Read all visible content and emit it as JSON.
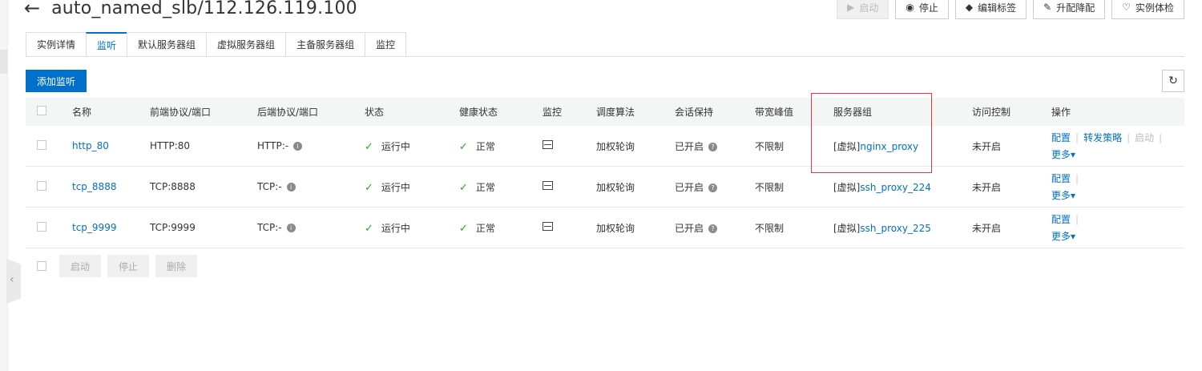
{
  "header": {
    "title": "auto_named_slb/112.126.119.100"
  },
  "actions": [
    {
      "label": "启动",
      "icon": "play-icon",
      "disabled": true
    },
    {
      "label": "停止",
      "icon": "stop-icon",
      "disabled": false
    },
    {
      "label": "编辑标签",
      "icon": "tag-icon",
      "disabled": false
    },
    {
      "label": "升配降配",
      "icon": "edit-icon",
      "disabled": false
    },
    {
      "label": "实例体检",
      "icon": "heart-icon",
      "disabled": false
    }
  ],
  "tabs": [
    "实例详情",
    "监听",
    "默认服务器组",
    "虚拟服务器组",
    "主备服务器组",
    "监控"
  ],
  "active_tab": "监听",
  "toolbar": {
    "add_label": "添加监听"
  },
  "table": {
    "headers": [
      "名称",
      "前端协议/端口",
      "后端协议/端口",
      "状态",
      "健康状态",
      "监控",
      "调度算法",
      "会话保持",
      "带宽峰值",
      "服务器组",
      "访问控制",
      "操作"
    ],
    "rows": [
      {
        "name": "http_80",
        "frontend": "HTTP:80",
        "backend": "HTTP:-",
        "status": "运行中",
        "health": "正常",
        "algorithm": "加权轮询",
        "session": "已开启",
        "bandwidth": "不限制",
        "group_prefix": "[虚拟]",
        "group_name": "nginx_proxy",
        "acl": "未开启",
        "ops": {
          "config": "配置",
          "forward": "转发策略",
          "start": "启动",
          "more": "更多"
        }
      },
      {
        "name": "tcp_8888",
        "frontend": "TCP:8888",
        "backend": "TCP:-",
        "status": "运行中",
        "health": "正常",
        "algorithm": "加权轮询",
        "session": "已开启",
        "bandwidth": "不限制",
        "group_prefix": "[虚拟]",
        "group_name": "ssh_proxy_224",
        "acl": "未开启",
        "ops": {
          "config": "配置",
          "more": "更多"
        }
      },
      {
        "name": "tcp_9999",
        "frontend": "TCP:9999",
        "backend": "TCP:-",
        "status": "运行中",
        "health": "正常",
        "algorithm": "加权轮询",
        "session": "已开启",
        "bandwidth": "不限制",
        "group_prefix": "[虚拟]",
        "group_name": "ssh_proxy_225",
        "acl": "未开启",
        "ops": {
          "config": "配置",
          "more": "更多"
        }
      }
    ]
  },
  "footer": {
    "start": "启动",
    "stop": "停止",
    "delete": "删除"
  },
  "colors": {
    "accent": "#0070cc",
    "success": "#2aa52a",
    "highlight": "#e03a3a"
  }
}
